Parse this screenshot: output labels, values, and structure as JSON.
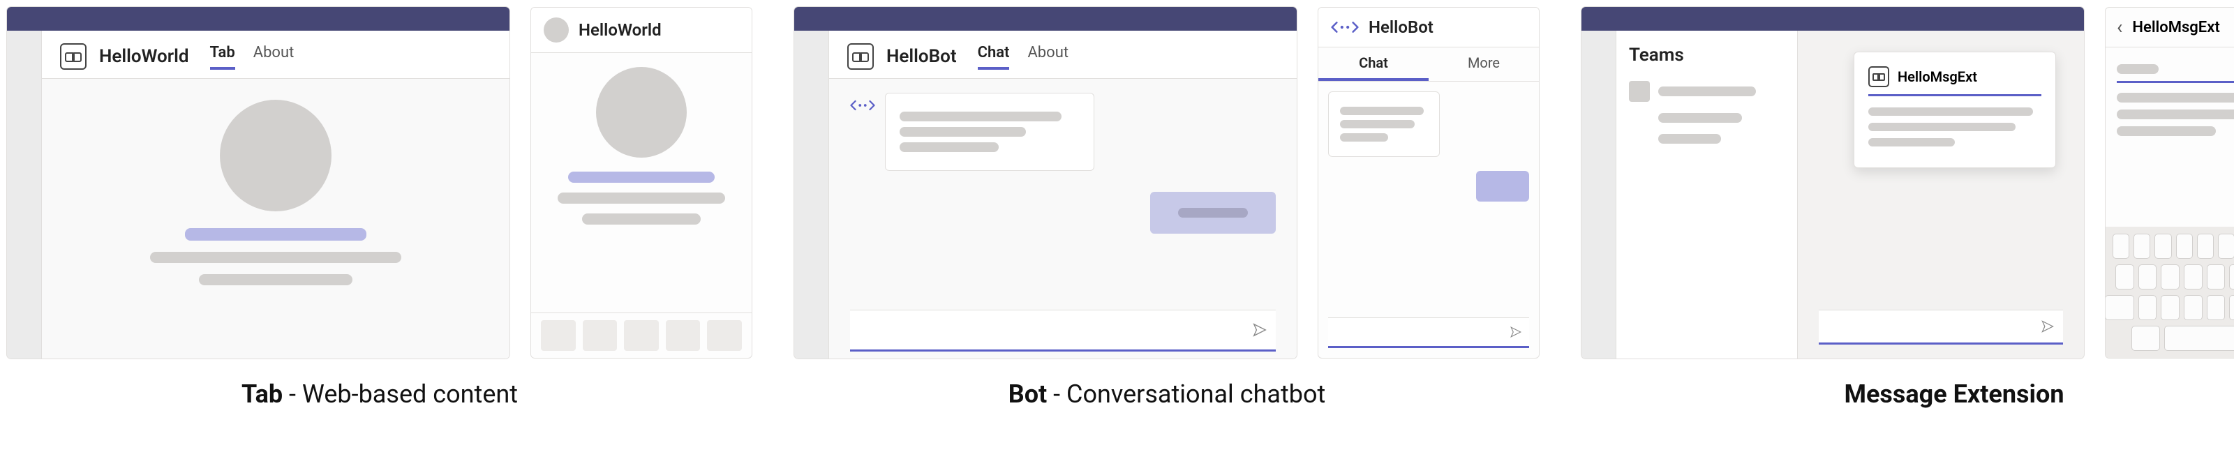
{
  "groups": {
    "tab": {
      "caption_bold": "Tab",
      "caption_rest": " - Web-based content",
      "desktop": {
        "app_name": "HelloWorld",
        "tabs": {
          "active": "Tab",
          "other": "About"
        }
      },
      "mobile": {
        "title": "HelloWorld"
      }
    },
    "bot": {
      "caption_bold": "Bot",
      "caption_rest": " - Conversational chatbot",
      "desktop": {
        "app_name": "HelloBot",
        "tabs": {
          "active": "Chat",
          "other": "About"
        }
      },
      "mobile": {
        "title": "HelloBot",
        "tabs": {
          "active": "Chat",
          "other": "More"
        }
      }
    },
    "msgext": {
      "caption_bold": "Message Extension",
      "caption_rest": "",
      "desktop": {
        "sidebar_title": "Teams",
        "card_title": "HelloMsgExt"
      },
      "mobile": {
        "title": "HelloMsgExt"
      }
    }
  },
  "colors": {
    "teams_bar": "#464775",
    "accent": "#5b5fc7",
    "accent_light": "#b6b8e6",
    "gray": "#d2d0ce"
  }
}
